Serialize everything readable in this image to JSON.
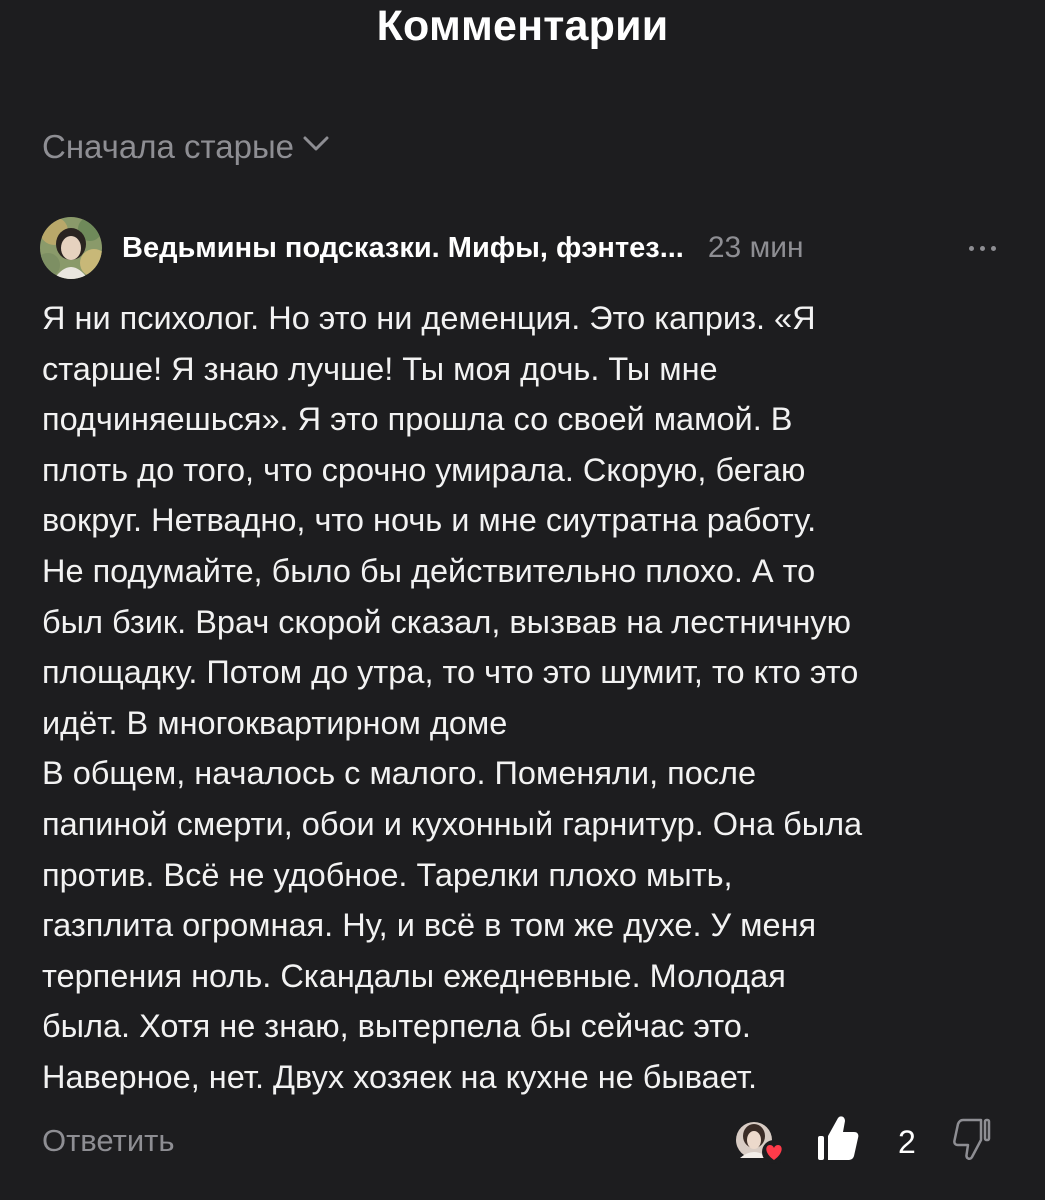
{
  "header": {
    "title": "Комментарии"
  },
  "sort": {
    "label": "Сначала старые",
    "icon": "chevron-down-icon"
  },
  "comment": {
    "author": "Ведьмины подсказки. Мифы, фэнтез...",
    "time": "23 мин",
    "more_icon": "more-horizontal-icon",
    "lines": [
      "Я ни психолог. Но это ни деменция. Это каприз. «Я",
      "старше! Я знаю лучше! Ты моя дочь. Ты мне",
      "подчиняешься». Я это прошла со своей мамой. В",
      "плоть до того, что срочно умирала. Скорую, бегаю",
      "вокруг. Нетвадно, что ночь и мне сиутратна работу.",
      "Не подумайте, было бы действительно плохо. А то",
      "был бзик. Врач скорой сказал, вызвав на лестничную",
      "площадку. Потом до утра, то что это шумит, то кто это",
      "идёт. В многоквартирном доме",
      "В общем, началось с малого. Поменяли, после",
      "папиной смерти, обои и кухонный гарнитур. Она была",
      "против. Всё не удобное. Тарелки плохо мыть,",
      "газплита огромная. Ну, и всё в том же духе. У меня",
      "терпения ноль. Скандалы ежедневные. Молодая",
      "была. Хотя не знаю, вытерпела бы сейчас это.",
      "Наверное, нет. Двух хозяек на кухне не бывает."
    ],
    "reply_label": "Ответить",
    "like_count": "2",
    "like_icon": "thumbs-up-icon",
    "dislike_icon": "thumbs-down-icon",
    "liker_badge_icon": "heart-icon"
  },
  "colors": {
    "background": "#1d1d1f",
    "text": "#f2f2f2",
    "muted": "#8e8e93",
    "heart": "#ff3b4a"
  }
}
